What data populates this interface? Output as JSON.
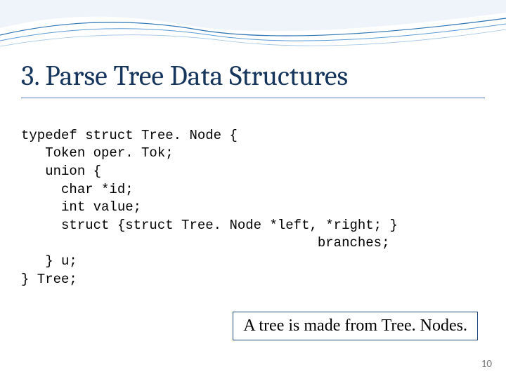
{
  "title": "3. Parse Tree Data Structures",
  "code": {
    "l0": "typedef struct Tree. Node {",
    "l1": "   Token oper. Tok;",
    "l2": "   union {",
    "l3": "     char *id;",
    "l4": "     int value;",
    "l5": "     struct {struct Tree. Node *left, *right; }",
    "l6": "                                     branches;",
    "l7": "   } u;",
    "l8": "} Tree;"
  },
  "callout": "A tree is made from Tree. Nodes.",
  "page_number": "10"
}
